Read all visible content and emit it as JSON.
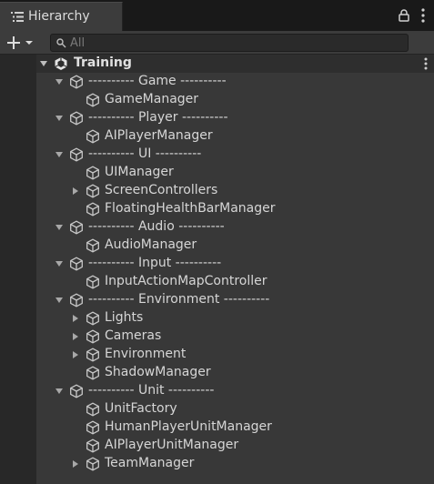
{
  "tab": {
    "title": "Hierarchy"
  },
  "search": {
    "placeholder": "All",
    "value": ""
  },
  "scene": {
    "name": "Training"
  },
  "items": [
    {
      "label": "---------- Game ----------",
      "depth": 1,
      "arrow": "expanded"
    },
    {
      "label": "GameManager",
      "depth": 2,
      "arrow": "none"
    },
    {
      "label": "---------- Player ----------",
      "depth": 1,
      "arrow": "expanded"
    },
    {
      "label": "AIPlayerManager",
      "depth": 2,
      "arrow": "none"
    },
    {
      "label": "---------- UI ----------",
      "depth": 1,
      "arrow": "expanded"
    },
    {
      "label": "UIManager",
      "depth": 2,
      "arrow": "none"
    },
    {
      "label": "ScreenControllers",
      "depth": 2,
      "arrow": "collapsed"
    },
    {
      "label": "FloatingHealthBarManager",
      "depth": 2,
      "arrow": "none"
    },
    {
      "label": "---------- Audio ----------",
      "depth": 1,
      "arrow": "expanded"
    },
    {
      "label": "AudioManager",
      "depth": 2,
      "arrow": "none"
    },
    {
      "label": "---------- Input ----------",
      "depth": 1,
      "arrow": "expanded"
    },
    {
      "label": "InputActionMapController",
      "depth": 2,
      "arrow": "none"
    },
    {
      "label": "---------- Environment ----------",
      "depth": 1,
      "arrow": "expanded"
    },
    {
      "label": "Lights",
      "depth": 2,
      "arrow": "collapsed"
    },
    {
      "label": "Cameras",
      "depth": 2,
      "arrow": "collapsed"
    },
    {
      "label": "Environment",
      "depth": 2,
      "arrow": "collapsed"
    },
    {
      "label": "ShadowManager",
      "depth": 2,
      "arrow": "none"
    },
    {
      "label": "---------- Unit ----------",
      "depth": 1,
      "arrow": "expanded"
    },
    {
      "label": "UnitFactory",
      "depth": 2,
      "arrow": "none"
    },
    {
      "label": "HumanPlayerUnitManager",
      "depth": 2,
      "arrow": "none"
    },
    {
      "label": "AIPlayerUnitManager",
      "depth": 2,
      "arrow": "none"
    },
    {
      "label": "TeamManager",
      "depth": 2,
      "arrow": "collapsed"
    }
  ],
  "icons": {
    "tab": "hierarchy-list-icon",
    "lock": "lock-icon",
    "tab_menu": "kebab-menu-icon",
    "add": "plus-dropdown-icon",
    "search": "search-icon",
    "scene_search": "scene-search-icon",
    "sort": "sort-icon",
    "scene": "unity-scene-icon",
    "gameobject": "cube-icon"
  },
  "colors": {
    "panel_bg": "#383838",
    "tab_bg": "#3c3c3c",
    "tabbar_bg": "#191919",
    "text": "#d2d2d2"
  }
}
